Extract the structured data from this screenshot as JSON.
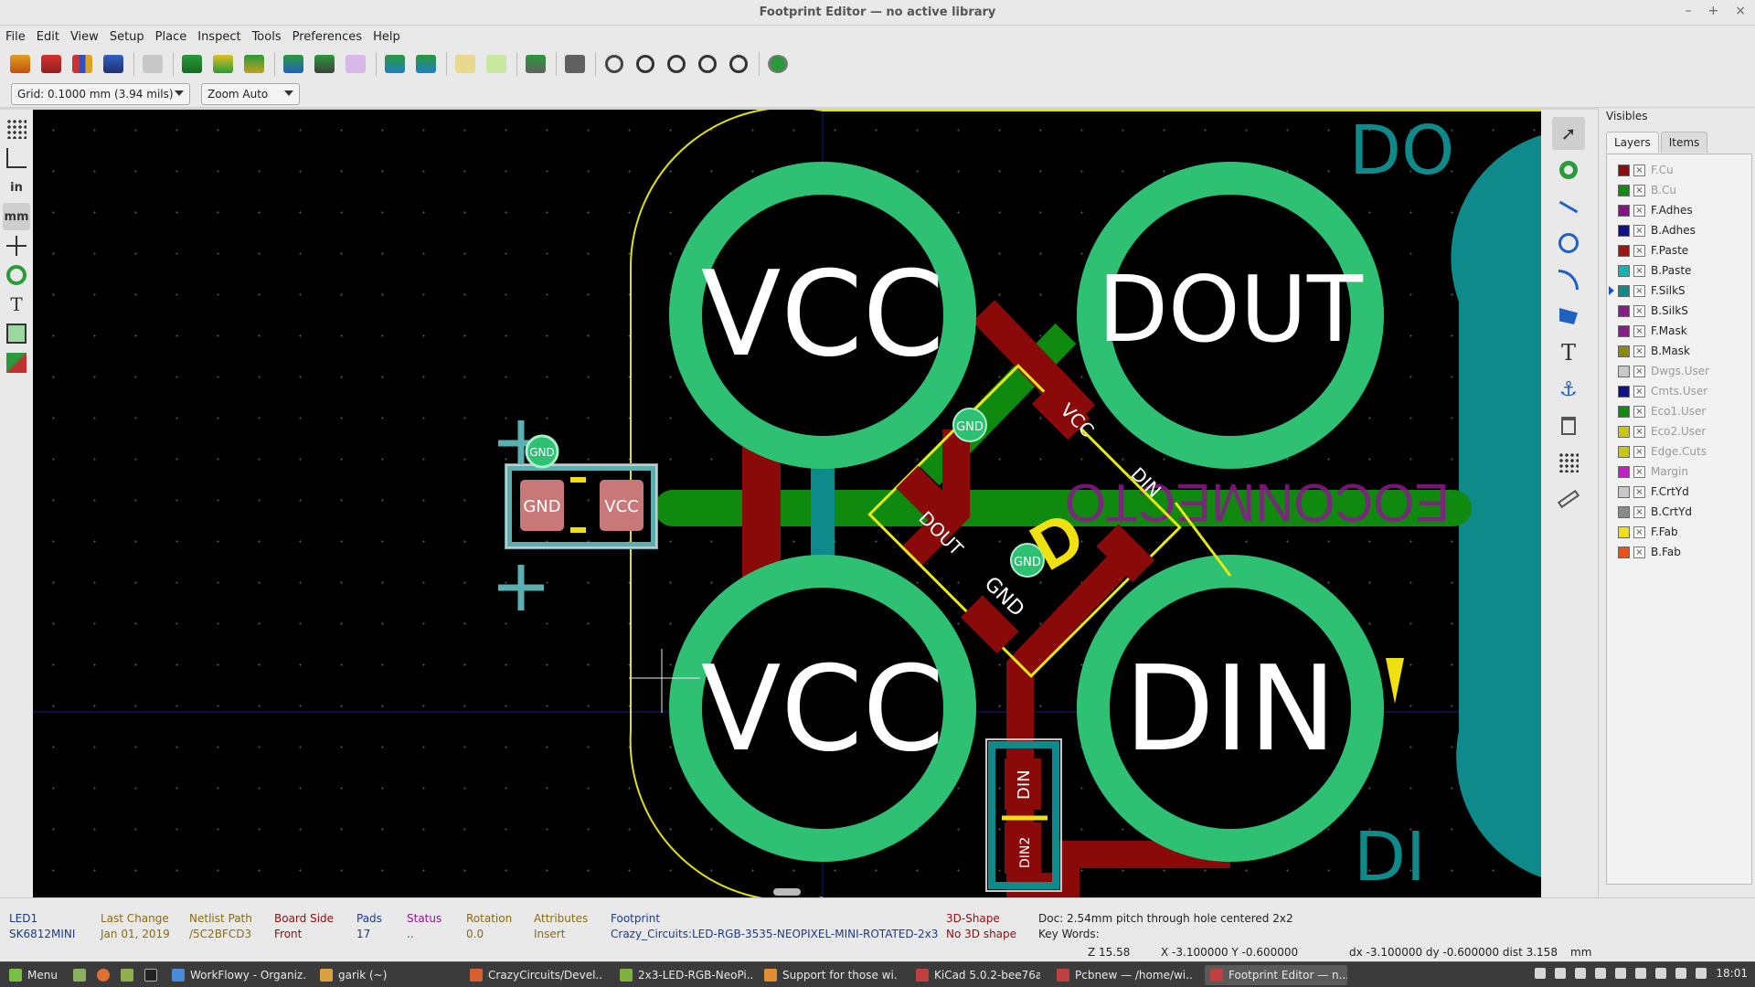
{
  "window": {
    "title": "Footprint Editor — no active library"
  },
  "menu": [
    "File",
    "Edit",
    "View",
    "Setup",
    "Place",
    "Inspect",
    "Tools",
    "Preferences",
    "Help"
  ],
  "options": {
    "grid": "Grid: 0.1000 mm (3.94 mils)",
    "zoom": "Zoom Auto"
  },
  "left_toolbar": {
    "units_inch": "in",
    "units_mm": "mm"
  },
  "visibles": {
    "header": "Visibles",
    "tabs": [
      "Layers",
      "Items"
    ],
    "layers": [
      {
        "name": "F.Cu",
        "color": "#8a1010",
        "dim": true
      },
      {
        "name": "B.Cu",
        "color": "#138a13",
        "dim": true
      },
      {
        "name": "F.Adhes",
        "color": "#8a108a",
        "dim": false
      },
      {
        "name": "B.Adhes",
        "color": "#10108a",
        "dim": false
      },
      {
        "name": "F.Paste",
        "color": "#a01414",
        "dim": false
      },
      {
        "name": "B.Paste",
        "color": "#14b4b4",
        "dim": false
      },
      {
        "name": "F.SilkS",
        "color": "#138a8a",
        "dim": false,
        "current": true
      },
      {
        "name": "B.SilkS",
        "color": "#8a1c8a",
        "dim": false
      },
      {
        "name": "F.Mask",
        "color": "#8a1c8a",
        "dim": false
      },
      {
        "name": "B.Mask",
        "color": "#8a8a10",
        "dim": false
      },
      {
        "name": "Dwgs.User",
        "color": "#c8c8c8",
        "dim": true
      },
      {
        "name": "Cmts.User",
        "color": "#10108a",
        "dim": true
      },
      {
        "name": "Eco1.User",
        "color": "#138a13",
        "dim": true
      },
      {
        "name": "Eco2.User",
        "color": "#c8c814",
        "dim": true
      },
      {
        "name": "Edge.Cuts",
        "color": "#c8c814",
        "dim": true
      },
      {
        "name": "Margin",
        "color": "#c81cc8",
        "dim": true
      },
      {
        "name": "F.CrtYd",
        "color": "#c8c8c8",
        "dim": false
      },
      {
        "name": "B.CrtYd",
        "color": "#8a8a8a",
        "dim": false
      },
      {
        "name": "F.Fab",
        "color": "#f0e010",
        "dim": false
      },
      {
        "name": "B.Fab",
        "color": "#f05010",
        "dim": false
      }
    ]
  },
  "canvas": {
    "pads": {
      "vcc_top": "VCC",
      "dout": "DOUT",
      "vcc_bottom": "VCC",
      "din": "DIN"
    },
    "small_pads": {
      "gnd": "GND",
      "vcc": "VCC",
      "dout": "DOUT",
      "din": "DIN",
      "din2": "DIN2",
      "via_gnd": "GND"
    },
    "silk": {
      "do": "DO",
      "di": "DI"
    }
  },
  "info": [
    {
      "label": "LED1",
      "value": "SK6812MINI",
      "color": "#1a3a8a"
    },
    {
      "label": "Last Change",
      "value": "Jan 01, 2019",
      "color": "#8a6a10"
    },
    {
      "label": "Netlist Path",
      "value": "/5C2BFCD3",
      "color": "#8a6a10"
    },
    {
      "label": "Board Side",
      "value": "Front",
      "color": "#8a1010"
    },
    {
      "label": "Pads",
      "value": "17",
      "color": "#1a3a8a"
    },
    {
      "label": "Status",
      "value": "..",
      "color": "#8a1a8a"
    },
    {
      "label": "Rotation",
      "value": "0.0",
      "color": "#8a6a10"
    },
    {
      "label": "Attributes",
      "value": "Insert",
      "color": "#8a6a10"
    },
    {
      "label": "Footprint",
      "value": "Crazy_Circuits:LED-RGB-3535-NEOPIXEL-MINI-ROTATED-2x3",
      "color": "#1a3a8a"
    },
    {
      "label": "3D-Shape",
      "value": "No 3D shape",
      "color": "#8a1010"
    }
  ],
  "doc": {
    "doc": "Doc: 2.54mm pitch through hole centered 2x2",
    "keywords": "Key Words:"
  },
  "status": {
    "zoom": "Z 15.58",
    "xy": "X -3.100000  Y -0.600000",
    "delta": "dx -3.100000  dy -0.600000  dist 3.158",
    "units": "mm"
  },
  "taskbar": {
    "menu": "Menu",
    "tasks": [
      {
        "label": "WorkFlowy - Organiz...",
        "color": "#4a8ad8"
      },
      {
        "label": "garik (~)",
        "color": "#d8a040"
      },
      {
        "label": "CrazyCircuits/Devel...",
        "color": "#d86030"
      },
      {
        "label": "2x3-LED-RGB-NeoPi...",
        "color": "#80b040"
      },
      {
        "label": "Support for those wi...",
        "color": "#e09030"
      },
      {
        "label": "KiCad 5.0.2-bee76a0...",
        "color": "#c04040"
      },
      {
        "label": "Pcbnew — /home/wi...",
        "color": "#c04040"
      },
      {
        "label": "Footprint Editor — n...",
        "color": "#c04040",
        "active": true
      }
    ],
    "clock": "18:01"
  }
}
